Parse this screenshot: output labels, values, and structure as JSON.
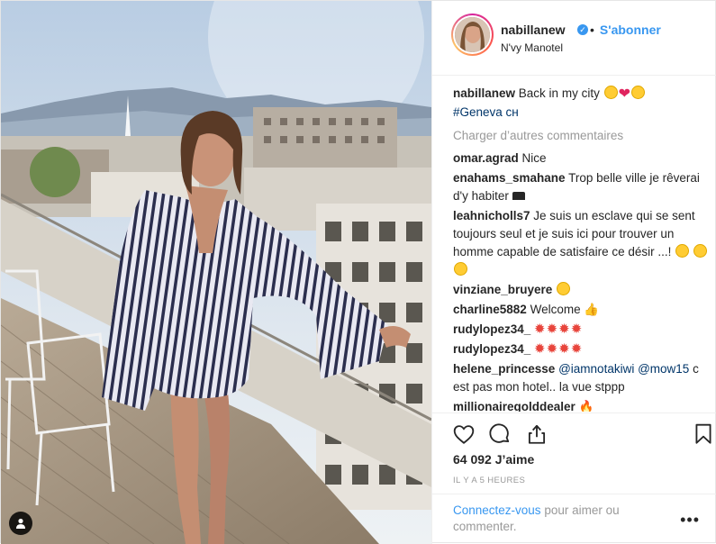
{
  "post": {
    "header": {
      "username": "nabillanew",
      "separator": "•",
      "follow_label": "S'abonner",
      "location": "N'vy Manotel"
    },
    "caption": {
      "username": "nabillanew",
      "text": "Back in my city",
      "hashtag": "#Geneva ᴄʜ"
    },
    "load_more_label": "Charger d’autres commentaires",
    "comments": [
      {
        "user": "omar.agrad",
        "text": "Nice"
      },
      {
        "user": "enahams_smahane",
        "text": "Trop belle ville je rêverai d'y habiter"
      },
      {
        "user": "leahnicholls7",
        "text": "Je suis un esclave qui se sent toujours seul et je suis ici pour trouver un homme capable de satisfaire ce désir ...!"
      },
      {
        "user": "vinziane_bruyere",
        "text": ""
      },
      {
        "user": "charline5882",
        "text": "Welcome"
      },
      {
        "user": "rudylopez34_",
        "text": ""
      },
      {
        "user": "rudylopez34_",
        "text": ""
      },
      {
        "user": "helene_princesse",
        "mentions": "@iamnotakiwi @mow15",
        "text": "c est pas mon hotel.. la vue stppp"
      },
      {
        "user": "millionairegolddealer",
        "text": ""
      }
    ],
    "likes": "64 092 J’aime",
    "time_ago": "IL Y A 5 HEURES",
    "footer": {
      "login_label": "Connectez-vous",
      "rest": "pour aimer ou commenter."
    },
    "icons": {
      "like": "heart-outline-icon",
      "comment": "comment-bubble-icon",
      "share": "share-icon",
      "save": "bookmark-icon",
      "more": "more-options-icon",
      "tag": "user-tag-icon"
    },
    "colors": {
      "accent": "#3897f0",
      "muted": "#999999",
      "text": "#262626"
    }
  }
}
